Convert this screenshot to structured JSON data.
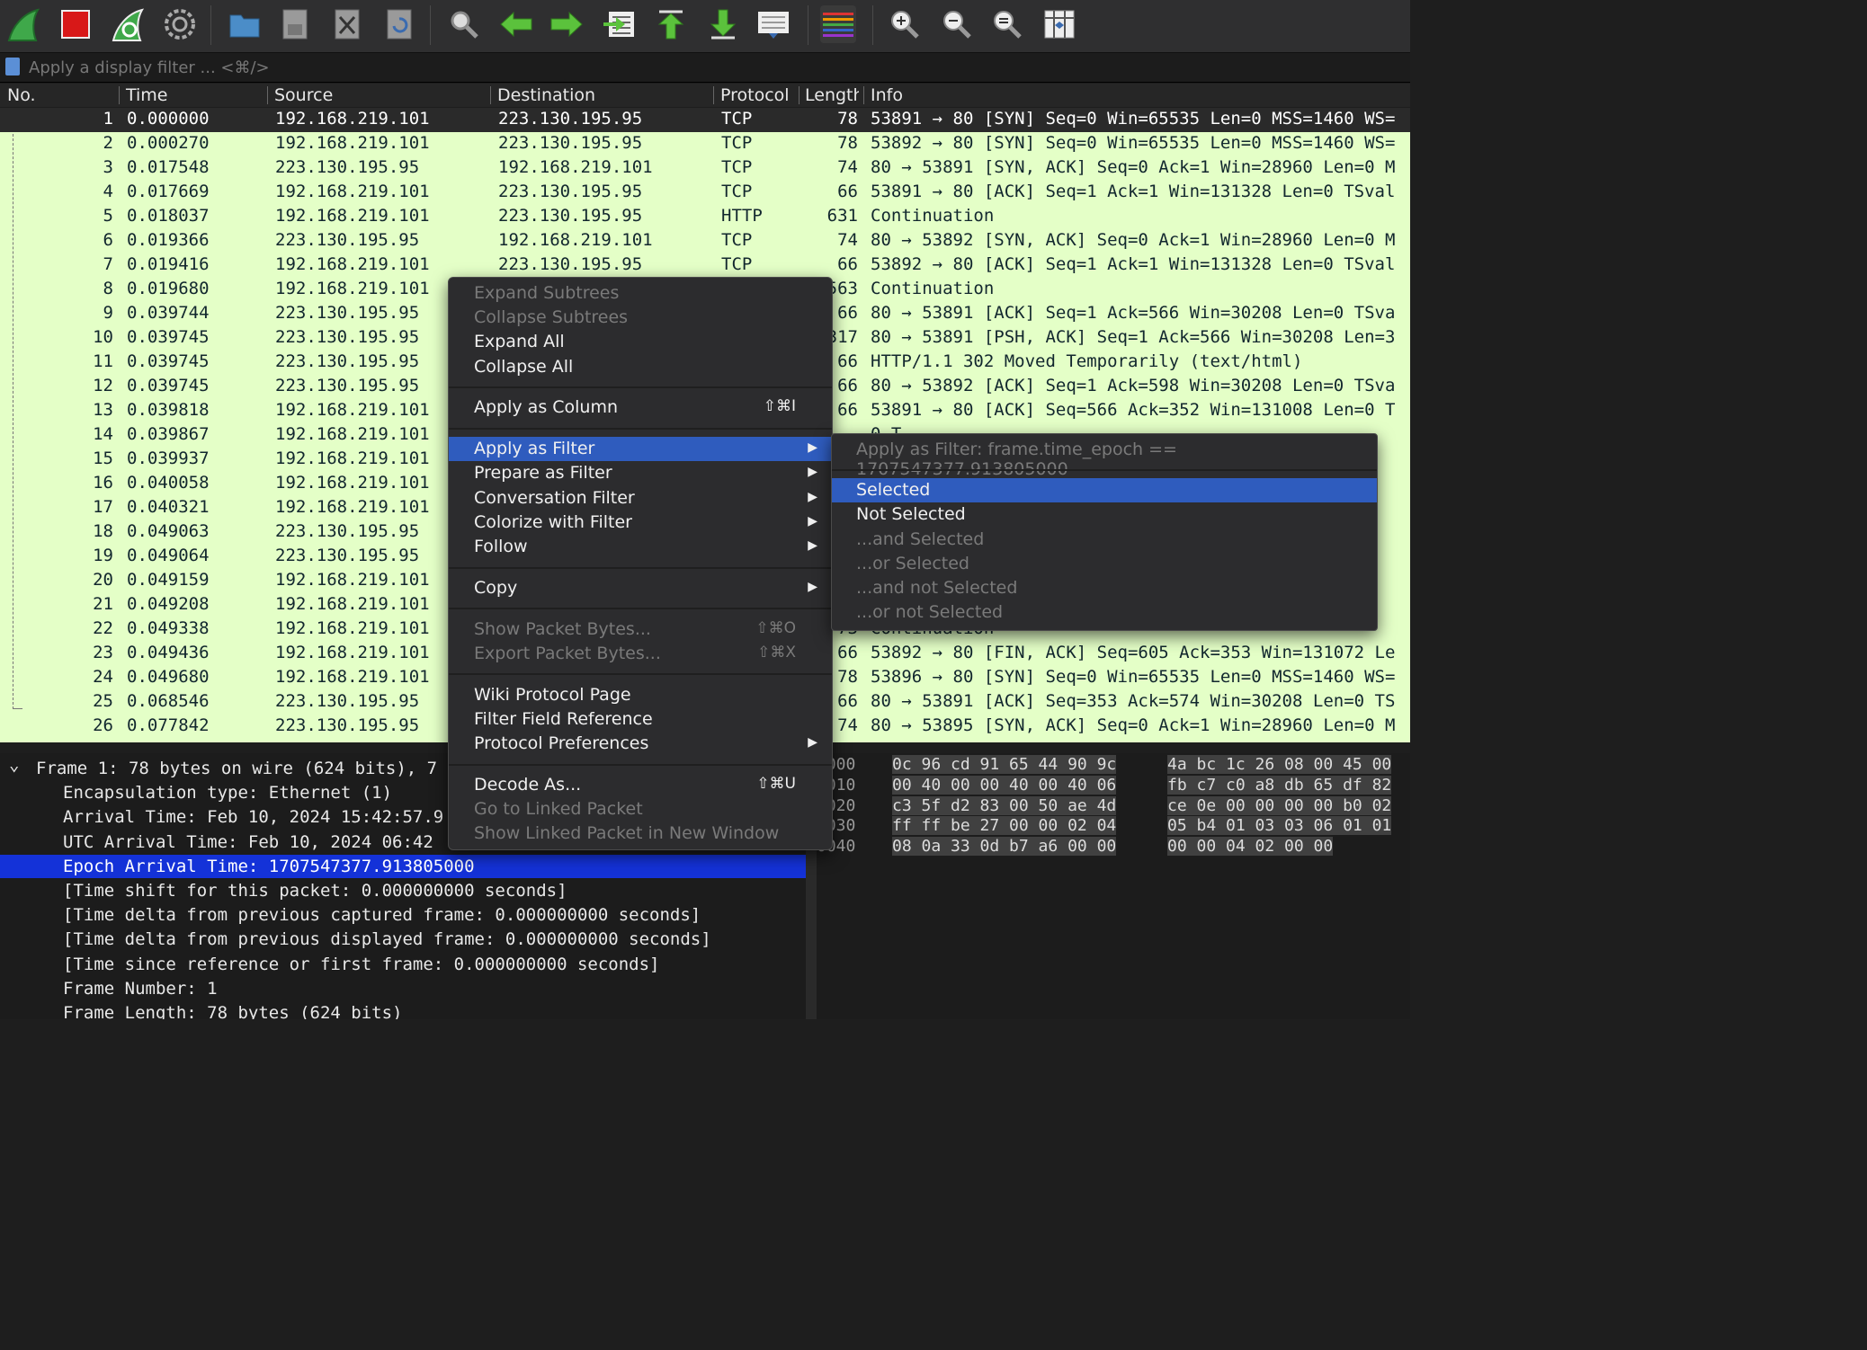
{
  "filter": {
    "placeholder": "Apply a display filter ... <⌘/>"
  },
  "columns": {
    "no": "No.",
    "time": "Time",
    "source": "Source",
    "destination": "Destination",
    "protocol": "Protocol",
    "length": "Length",
    "info": "Info"
  },
  "packets": [
    {
      "no": "1",
      "time": "0.000000",
      "src": "192.168.219.101",
      "dst": "223.130.195.95",
      "proto": "TCP",
      "len": "78",
      "info": "53891 → 80 [SYN] Seq=0 Win=65535 Len=0 MSS=1460 WS="
    },
    {
      "no": "2",
      "time": "0.000270",
      "src": "192.168.219.101",
      "dst": "223.130.195.95",
      "proto": "TCP",
      "len": "78",
      "info": "53892 → 80 [SYN] Seq=0 Win=65535 Len=0 MSS=1460 WS="
    },
    {
      "no": "3",
      "time": "0.017548",
      "src": "223.130.195.95",
      "dst": "192.168.219.101",
      "proto": "TCP",
      "len": "74",
      "info": "80 → 53891 [SYN, ACK] Seq=0 Ack=1 Win=28960 Len=0 M"
    },
    {
      "no": "4",
      "time": "0.017669",
      "src": "192.168.219.101",
      "dst": "223.130.195.95",
      "proto": "TCP",
      "len": "66",
      "info": "53891 → 80 [ACK] Seq=1 Ack=1 Win=131328 Len=0 TSval"
    },
    {
      "no": "5",
      "time": "0.018037",
      "src": "192.168.219.101",
      "dst": "223.130.195.95",
      "proto": "HTTP",
      "len": "631",
      "info": "Continuation"
    },
    {
      "no": "6",
      "time": "0.019366",
      "src": "223.130.195.95",
      "dst": "192.168.219.101",
      "proto": "TCP",
      "len": "74",
      "info": "80 → 53892 [SYN, ACK] Seq=0 Ack=1 Win=28960 Len=0 M"
    },
    {
      "no": "7",
      "time": "0.019416",
      "src": "192.168.219.101",
      "dst": "223.130.195.95",
      "proto": "TCP",
      "len": "66",
      "info": "53892 → 80 [ACK] Seq=1 Ack=1 Win=131328 Len=0 TSval"
    },
    {
      "no": "8",
      "time": "0.019680",
      "src": "192.168.219.101",
      "dst": "",
      "proto": "",
      "len": "563",
      "info": "Continuation"
    },
    {
      "no": "9",
      "time": "0.039744",
      "src": "223.130.195.95",
      "dst": "",
      "proto": "",
      "len": "66",
      "info": "80 → 53891 [ACK] Seq=1 Ack=566 Win=30208 Len=0 TSva"
    },
    {
      "no": "10",
      "time": "0.039745",
      "src": "223.130.195.95",
      "dst": "",
      "proto": "",
      "len": "317",
      "info": "80 → 53891 [PSH, ACK] Seq=1 Ack=566 Win=30208 Len=3"
    },
    {
      "no": "11",
      "time": "0.039745",
      "src": "223.130.195.95",
      "dst": "",
      "proto": "",
      "len": "66",
      "info": "HTTP/1.1 302 Moved Temporarily  (text/html)"
    },
    {
      "no": "12",
      "time": "0.039745",
      "src": "223.130.195.95",
      "dst": "",
      "proto": "",
      "len": "66",
      "info": "80 → 53892 [ACK] Seq=1 Ack=598 Win=30208 Len=0 TSva"
    },
    {
      "no": "13",
      "time": "0.039818",
      "src": "192.168.219.101",
      "dst": "",
      "proto": "",
      "len": "66",
      "info": "53891 → 80 [ACK] Seq=566 Ack=352 Win=131008 Len=0 T"
    },
    {
      "no": "14",
      "time": "0.039867",
      "src": "192.168.219.101",
      "dst": "",
      "proto": "",
      "len": "",
      "info": "0 T"
    },
    {
      "no": "15",
      "time": "0.039937",
      "src": "192.168.219.101",
      "dst": "",
      "proto": "",
      "len": "",
      "info": ""
    },
    {
      "no": "16",
      "time": "0.040058",
      "src": "192.168.219.101",
      "dst": "",
      "proto": "",
      "len": "",
      "info": "2 Le"
    },
    {
      "no": "17",
      "time": "0.040321",
      "src": "192.168.219.101",
      "dst": "",
      "proto": "",
      "len": "",
      "info": "WS="
    },
    {
      "no": "18",
      "time": "0.049063",
      "src": "223.130.195.95",
      "dst": "",
      "proto": "",
      "len": "",
      "info": "en=3"
    },
    {
      "no": "19",
      "time": "0.049064",
      "src": "223.130.195.95",
      "dst": "",
      "proto": "",
      "len": "",
      "info": ""
    },
    {
      "no": "20",
      "time": "0.049159",
      "src": "192.168.219.101",
      "dst": "",
      "proto": "",
      "len": "",
      "info": "0 T"
    },
    {
      "no": "21",
      "time": "0.049208",
      "src": "192.168.219.101",
      "dst": "",
      "proto": "",
      "len": "",
      "info": "0 T"
    },
    {
      "no": "22",
      "time": "0.049338",
      "src": "192.168.219.101",
      "dst": "",
      "proto": "",
      "len": "73",
      "info": "Continuation"
    },
    {
      "no": "23",
      "time": "0.049436",
      "src": "192.168.219.101",
      "dst": "",
      "proto": "",
      "len": "66",
      "info": "53892 → 80 [FIN, ACK] Seq=605 Ack=353 Win=131072 Le"
    },
    {
      "no": "24",
      "time": "0.049680",
      "src": "192.168.219.101",
      "dst": "",
      "proto": "",
      "len": "78",
      "info": "53896 → 80 [SYN] Seq=0 Win=65535 Len=0 MSS=1460 WS="
    },
    {
      "no": "25",
      "time": "0.068546",
      "src": "223.130.195.95",
      "dst": "",
      "proto": "",
      "len": "66",
      "info": "80 → 53891 [ACK] Seq=353 Ack=574 Win=30208 Len=0 TS"
    },
    {
      "no": "26",
      "time": "0.077842",
      "src": "223.130.195.95",
      "dst": "",
      "proto": "",
      "len": "74",
      "info": "80 → 53895 [SYN, ACK] Seq=0 Ack=1 Win=28960 Len=0 M"
    }
  ],
  "details": [
    {
      "text": "Frame 1: 78 bytes on wire (624 bits), 7",
      "indent": 0,
      "expander": "⌄"
    },
    {
      "text": "Encapsulation type: Ethernet (1)",
      "indent": 1
    },
    {
      "text": "Arrival Time: Feb 10, 2024 15:42:57.9",
      "indent": 1
    },
    {
      "text": "UTC Arrival Time: Feb 10, 2024 06:42",
      "indent": 1
    },
    {
      "text": "Epoch Arrival Time: 1707547377.913805000",
      "indent": 1,
      "highlight": true
    },
    {
      "text": "[Time shift for this packet: 0.000000000 seconds]",
      "indent": 1
    },
    {
      "text": "[Time delta from previous captured frame: 0.000000000 seconds]",
      "indent": 1
    },
    {
      "text": "[Time delta from previous displayed frame: 0.000000000 seconds]",
      "indent": 1
    },
    {
      "text": "[Time since reference or first frame: 0.000000000 seconds]",
      "indent": 1
    },
    {
      "text": "Frame Number: 1",
      "indent": 1
    },
    {
      "text": "Frame Length: 78 bytes (624 bits)",
      "indent": 1
    }
  ],
  "hex": [
    {
      "off": "0000",
      "a": "0c 96 cd 91 65 44 90 9c",
      "b": "4a bc 1c 26 08 00 45 00"
    },
    {
      "off": "0010",
      "a": "00 40 00 00 40 00 40 06",
      "b": "fb c7 c0 a8 db 65 df 82"
    },
    {
      "off": "0020",
      "a": "c3 5f d2 83 00 50 ae 4d",
      "b": "ce 0e 00 00 00 00 b0 02"
    },
    {
      "off": "0030",
      "a": "ff ff be 27 00 00 02 04",
      "b": "05 b4 01 03 03 06 01 01"
    },
    {
      "off": "0040",
      "a": "08 0a 33 0d b7 a6 00 00",
      "b": "00 00 04 02 00 00"
    }
  ],
  "context_menu": {
    "items": [
      {
        "label": "Expand Subtrees",
        "disabled": true
      },
      {
        "label": "Collapse Subtrees",
        "disabled": true
      },
      {
        "label": "Expand All"
      },
      {
        "label": "Collapse All"
      },
      {
        "sep": true
      },
      {
        "label": "Apply as Column",
        "shortcut": "⇧⌘I"
      },
      {
        "sep": true
      },
      {
        "label": "Apply as Filter",
        "submenu": true,
        "active": true
      },
      {
        "label": "Prepare as Filter",
        "submenu": true
      },
      {
        "label": "Conversation Filter",
        "submenu": true
      },
      {
        "label": "Colorize with Filter",
        "submenu": true
      },
      {
        "label": "Follow",
        "submenu": true
      },
      {
        "sep": true
      },
      {
        "label": "Copy",
        "submenu": true
      },
      {
        "sep": true
      },
      {
        "label": "Show Packet Bytes...",
        "shortcut": "⇧⌘O",
        "disabled": true
      },
      {
        "label": "Export Packet Bytes...",
        "shortcut": "⇧⌘X",
        "disabled": true
      },
      {
        "sep": true
      },
      {
        "label": "Wiki Protocol Page"
      },
      {
        "label": "Filter Field Reference"
      },
      {
        "label": "Protocol Preferences",
        "submenu": true
      },
      {
        "sep": true
      },
      {
        "label": "Decode As...",
        "shortcut": "⇧⌘U"
      },
      {
        "label": "Go to Linked Packet",
        "disabled": true
      },
      {
        "label": "Show Linked Packet in New Window",
        "disabled": true
      }
    ]
  },
  "submenu": {
    "items": [
      {
        "label": "Apply as Filter: frame.time_epoch == 1707547377.913805000",
        "disabled": true
      },
      {
        "sep": true
      },
      {
        "label": "Selected",
        "active": true
      },
      {
        "label": "Not Selected"
      },
      {
        "label": "...and Selected",
        "disabled": true
      },
      {
        "label": "...or Selected",
        "disabled": true
      },
      {
        "label": "...and not Selected",
        "disabled": true
      },
      {
        "label": "...or not Selected",
        "disabled": true
      }
    ]
  },
  "toolbar_icons": [
    "shark-fin-start-icon",
    "stop-square-icon",
    "restart-fin-icon",
    "gear-options-icon",
    "open-folder-icon",
    "save-file-icon",
    "close-file-icon",
    "reload-icon",
    "search-icon",
    "arrow-left-icon",
    "arrow-right-icon",
    "go-to-packet-icon",
    "first-packet-icon",
    "last-packet-icon",
    "autoscroll-icon",
    "colorize-icon",
    "zoom-in-icon",
    "zoom-out-icon",
    "zoom-reset-icon",
    "resize-columns-icon"
  ],
  "colors": {
    "packet_bg": "#e4ffc7",
    "selected_row": "#2a2a2a",
    "menu_active": "#2f5cbe",
    "detail_highlight": "#1432d8"
  }
}
